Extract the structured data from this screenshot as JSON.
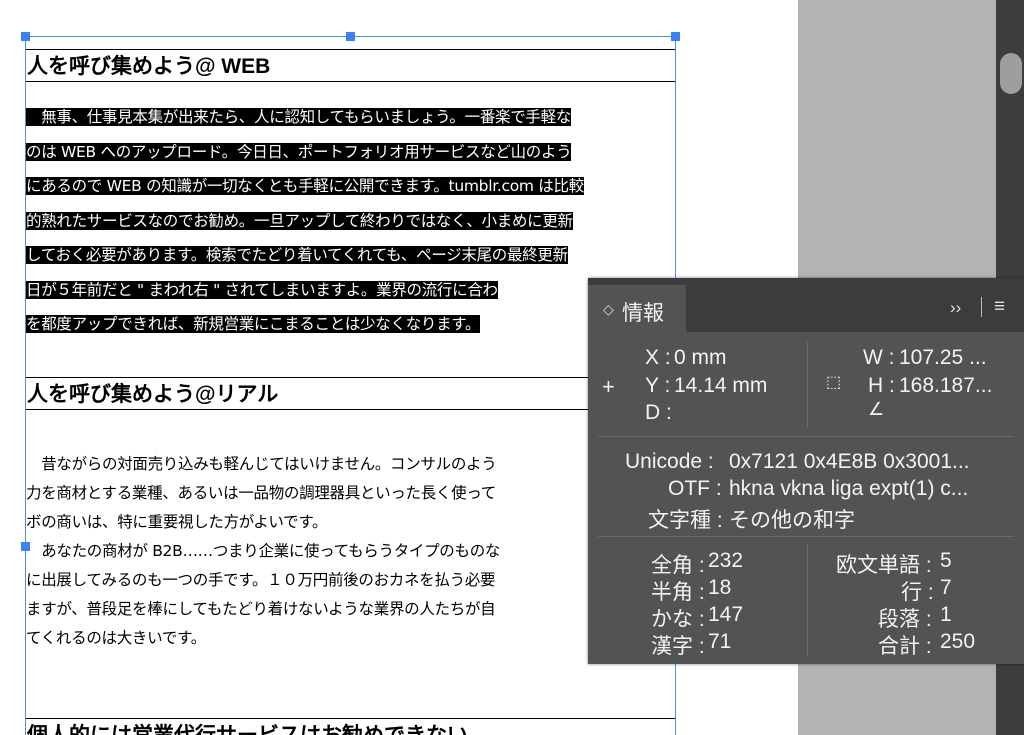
{
  "document": {
    "heading1": "人を呼び集めよう@ WEB",
    "para1_lines": [
      "　無事、仕事見本集が出来たら、人に認知してもらいましょう。一番楽で手軽な",
      "のは WEB へのアップロード。今日日、ポートフォリオ用サービスなど山のよう",
      "にあるので WEB の知識が一切なくとも手軽に公開できます。tumblr.com は比較",
      "的熟れたサービスなのでお勧め。一旦アップして終わりではなく、小まめに更新",
      "しておく必要があります。検索でたどり着いてくれても、ページ末尾の最終更新",
      "日が５年前だと \" まわれ右 \" されてしまいますよ。業界の流行に合わ",
      "を都度アップできれば、新規営業にこまることは少なくなります。"
    ],
    "heading2": "人を呼び集めよう@リアル",
    "para2_lines": [
      "　昔ながらの対面売り込みも軽んじてはいけません。コンサルのよう",
      "力を商材とする業種、あるいは一品物の調理器具といった長く使って",
      "ボの商いは、特に重要視した方がよいです。",
      "　あなたの商材が B2B……つまり企業に使ってもらうタイプのものな",
      "に出展してみるのも一つの手です。１０万円前後のおカネを払う必要",
      "ますが、普段足を棒にしてもたどり着けないような業界の人たちが自",
      "てくれるのは大きいです。"
    ],
    "heading3": "個人的には営業代行サービスはお勧めできない"
  },
  "info_panel": {
    "tab_label": "情報",
    "tab_chevron": "◇",
    "overflow": "››",
    "menu": "≡",
    "x_label": "X :",
    "x_value": "0 mm",
    "y_label": "Y :",
    "y_value": "14.14 mm",
    "d_label": "D :",
    "d_value": "",
    "w_label": "W :",
    "w_value": "107.25 ...",
    "h_label": "H :",
    "h_value": "168.187...",
    "unicode_label": "Unicode :",
    "unicode_value": "0x7121 0x4E8B 0x3001...",
    "otf_label": "OTF :",
    "otf_value": "hkna vkna liga expt(1) c...",
    "charset_label": "文字種 :",
    "charset_value": "その他の和字",
    "zenkaku_label": "全角 :",
    "zenkaku_value": "232",
    "hankaku_label": "半角 :",
    "hankaku_value": "18",
    "kana_label": "かな :",
    "kana_value": "147",
    "kanji_label": "漢字 :",
    "kanji_value": "71",
    "words_label": "欧文単語 :",
    "words_value": "5",
    "lines_label": "行 :",
    "lines_value": "7",
    "paras_label": "段落 :",
    "paras_value": "1",
    "total_label": "合計 :",
    "total_value": "250"
  },
  "colors": {
    "selection_blue": "#3a82f6",
    "panel_bg": "#535353",
    "panel_tabbar": "#3c3c3c",
    "pasteboard": "#b3b3b3"
  }
}
